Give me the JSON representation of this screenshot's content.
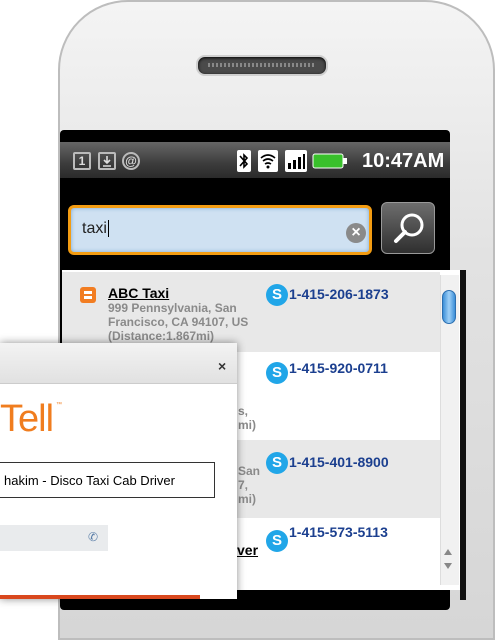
{
  "statusbar": {
    "icons": [
      "calendar-icon",
      "download-icon",
      "at-sign-icon",
      "bluetooth-icon",
      "wifi-icon",
      "signal-icon",
      "battery-icon"
    ],
    "time": "10:47AM",
    "icon_glyphs": {
      "calendar": "1",
      "at": "@"
    }
  },
  "search": {
    "value": "taxi",
    "clear_glyph": "×"
  },
  "results": [
    {
      "name": "ABC Taxi",
      "address": "999 Pennsylvania, San Francisco, CA 94107, US (Distance:1.867mi)",
      "phone": "1-415-206-1873"
    },
    {
      "partial_text": "s, mi)",
      "phone": "1-415-920-0711"
    },
    {
      "partial_text": "San 7, mi)",
      "phone": "1-415-401-8900"
    },
    {
      "partial_text": "ver",
      "phone": "1-415-573-5113"
    }
  ],
  "dialog": {
    "close": "×",
    "logo": "Tell",
    "logo_tm": "™",
    "field_value": "hakim - Disco Taxi Cab Driver"
  },
  "colors": {
    "accent": "#f39c12",
    "phone_link": "#1b3f8f",
    "skype": "#21a6e8"
  }
}
